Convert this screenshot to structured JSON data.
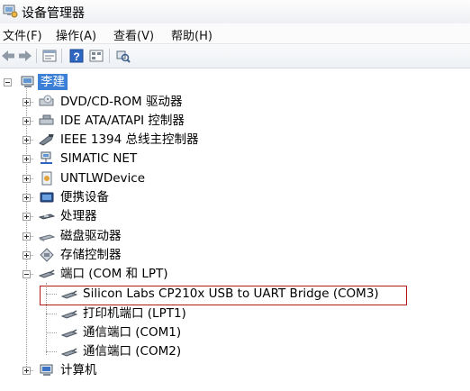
{
  "window": {
    "title": "设备管理器"
  },
  "menu": [
    {
      "label": "文件(F)"
    },
    {
      "label": "操作(A)"
    },
    {
      "label": "查看(V)"
    },
    {
      "label": "帮助(H)"
    }
  ],
  "tree": {
    "root": {
      "label": "李建"
    },
    "categories": [
      {
        "label": "DVD/CD-ROM 驱动器",
        "icon": "dvd-drive-icon"
      },
      {
        "label": "IDE ATA/ATAPI 控制器",
        "icon": "ide-controller-icon"
      },
      {
        "label": "IEEE 1394 总线主控制器",
        "icon": "ieee1394-icon"
      },
      {
        "label": "SIMATIC NET",
        "icon": "network-icon"
      },
      {
        "label": "UNTLWDevice",
        "icon": "usb-device-icon"
      },
      {
        "label": "便携设备",
        "icon": "portable-device-icon"
      },
      {
        "label": "处理器",
        "icon": "processor-icon"
      },
      {
        "label": "磁盘驱动器",
        "icon": "disk-drive-icon"
      },
      {
        "label": "存储控制器",
        "icon": "storage-controller-icon"
      },
      {
        "label": "端口 (COM 和 LPT)",
        "icon": "port-icon"
      }
    ],
    "ports": [
      {
        "label": "Silicon Labs CP210x USB to UART Bridge (COM3)"
      },
      {
        "label": "打印机端口 (LPT1)"
      },
      {
        "label": "通信端口 (COM1)"
      },
      {
        "label": "通信端口 (COM2)"
      }
    ],
    "last": {
      "label": "计算机"
    }
  }
}
